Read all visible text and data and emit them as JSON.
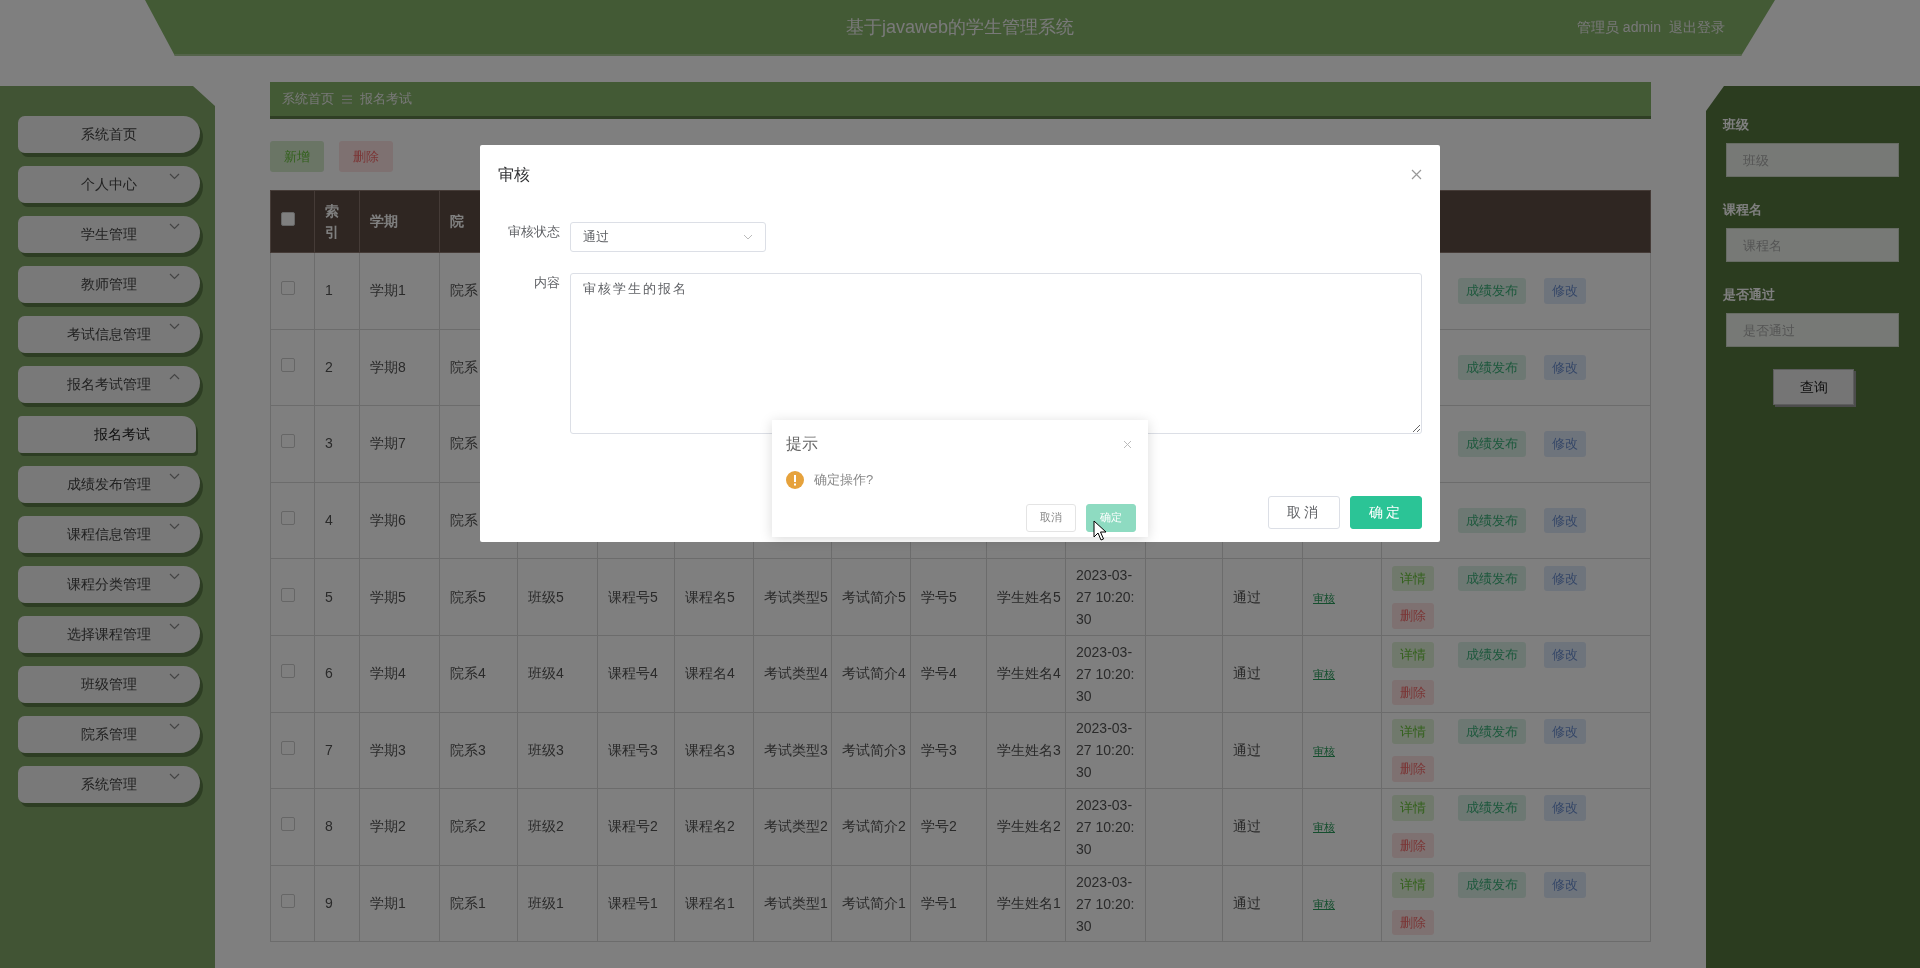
{
  "header": {
    "title": "基于javaweb的学生管理系统",
    "user": "管理员 admin",
    "logout": "退出登录"
  },
  "sidebar": {
    "items": [
      {
        "label": "系统首页",
        "kind": "link"
      },
      {
        "label": "个人中心",
        "kind": "menu",
        "expanded": false
      },
      {
        "label": "学生管理",
        "kind": "menu",
        "expanded": false
      },
      {
        "label": "教师管理",
        "kind": "menu",
        "expanded": false
      },
      {
        "label": "考试信息管理",
        "kind": "menu",
        "expanded": false
      },
      {
        "label": "报名考试管理",
        "kind": "menu",
        "expanded": true,
        "children": [
          {
            "label": "报名考试"
          }
        ]
      },
      {
        "label": "成绩发布管理",
        "kind": "menu",
        "expanded": false
      },
      {
        "label": "课程信息管理",
        "kind": "menu",
        "expanded": false
      },
      {
        "label": "课程分类管理",
        "kind": "menu",
        "expanded": false
      },
      {
        "label": "选择课程管理",
        "kind": "menu",
        "expanded": false
      },
      {
        "label": "班级管理",
        "kind": "menu",
        "expanded": false
      },
      {
        "label": "院系管理",
        "kind": "menu",
        "expanded": false
      },
      {
        "label": "系统管理",
        "kind": "menu",
        "expanded": false
      }
    ]
  },
  "breadcrumb": [
    "系统首页",
    "报名考试"
  ],
  "toolbar": [
    {
      "label": "新增",
      "kind": "add"
    },
    {
      "label": "删除",
      "kind": "delete"
    }
  ],
  "table": {
    "select_all": {
      "checked": false
    },
    "columns": [
      "索引",
      "学期",
      "院"
    ],
    "rows": [
      {
        "checked": false,
        "cells": [
          "1",
          "学期1",
          "院系"
        ],
        "actions": [
          {
            "label": "成绩发布",
            "kind": "publish"
          },
          {
            "label": "修改",
            "kind": "edit"
          }
        ]
      },
      {
        "checked": false,
        "cells": [
          "2",
          "学期8",
          "院系"
        ],
        "actions": [
          {
            "label": "成绩发布",
            "kind": "publish"
          },
          {
            "label": "修改",
            "kind": "edit"
          }
        ]
      },
      {
        "checked": false,
        "cells": [
          "3",
          "学期7",
          "院系"
        ],
        "actions": [
          {
            "label": "成绩发布",
            "kind": "publish"
          },
          {
            "label": "修改",
            "kind": "edit"
          }
        ]
      },
      {
        "checked": false,
        "cells": [
          "4",
          "学期6",
          "院系"
        ],
        "actions": [
          {
            "label": "成绩发布",
            "kind": "publish"
          },
          {
            "label": "修改",
            "kind": "edit"
          }
        ]
      },
      {
        "checked": false,
        "cells": [
          "5",
          "学期5",
          "院系5",
          "班级5",
          "课程号5",
          "课程名5",
          "考试类型5",
          "考试简介5",
          "学号5",
          "学生姓名5",
          "2023-03-27 10:20:30"
        ],
        "passed": "通过",
        "review": "审核",
        "actions": [
          {
            "label": "详情",
            "kind": "detail"
          },
          {
            "label": "成绩发布",
            "kind": "publish"
          },
          {
            "label": "修改",
            "kind": "edit"
          },
          {
            "label": "删除",
            "kind": "delete"
          }
        ]
      },
      {
        "checked": false,
        "cells": [
          "6",
          "学期4",
          "院系4",
          "班级4",
          "课程号4",
          "课程名4",
          "考试类型4",
          "考试简介4",
          "学号4",
          "学生姓名4",
          "2023-03-27 10:20:30"
        ],
        "passed": "通过",
        "review": "审核",
        "actions": [
          {
            "label": "详情",
            "kind": "detail"
          },
          {
            "label": "成绩发布",
            "kind": "publish"
          },
          {
            "label": "修改",
            "kind": "edit"
          },
          {
            "label": "删除",
            "kind": "delete"
          }
        ]
      },
      {
        "checked": false,
        "cells": [
          "7",
          "学期3",
          "院系3",
          "班级3",
          "课程号3",
          "课程名3",
          "考试类型3",
          "考试简介3",
          "学号3",
          "学生姓名3",
          "2023-03-27 10:20:30"
        ],
        "passed": "通过",
        "review": "审核",
        "actions": [
          {
            "label": "详情",
            "kind": "detail"
          },
          {
            "label": "成绩发布",
            "kind": "publish"
          },
          {
            "label": "修改",
            "kind": "edit"
          },
          {
            "label": "删除",
            "kind": "delete"
          }
        ]
      },
      {
        "checked": false,
        "cells": [
          "8",
          "学期2",
          "院系2",
          "班级2",
          "课程号2",
          "课程名2",
          "考试类型2",
          "考试简介2",
          "学号2",
          "学生姓名2",
          "2023-03-27 10:20:30"
        ],
        "passed": "通过",
        "review": "审核",
        "actions": [
          {
            "label": "详情",
            "kind": "detail"
          },
          {
            "label": "成绩发布",
            "kind": "publish"
          },
          {
            "label": "修改",
            "kind": "edit"
          },
          {
            "label": "删除",
            "kind": "delete"
          }
        ]
      },
      {
        "checked": false,
        "cells": [
          "9",
          "学期1",
          "院系1",
          "班级1",
          "课程号1",
          "课程名1",
          "考试类型1",
          "考试简介1",
          "学号1",
          "学生姓名1",
          "2023-03-27 10:20:30"
        ],
        "passed": "通过",
        "review": "审核",
        "actions": [
          {
            "label": "详情",
            "kind": "detail"
          },
          {
            "label": "成绩发布",
            "kind": "publish"
          },
          {
            "label": "修改",
            "kind": "edit"
          },
          {
            "label": "删除",
            "kind": "delete"
          }
        ]
      }
    ]
  },
  "search": {
    "fields": [
      {
        "label": "班级",
        "placeholder": "班级"
      },
      {
        "label": "课程名",
        "placeholder": "课程名"
      },
      {
        "label": "是否通过",
        "placeholder": "是否通过"
      }
    ],
    "button": "查询"
  },
  "dialog": {
    "title": "审核",
    "fields": [
      {
        "label": "审核状态",
        "kind": "select",
        "value": "通过"
      },
      {
        "label": "内容",
        "kind": "textarea",
        "value": "审核学生的报名"
      }
    ],
    "buttons": [
      {
        "label": "取消",
        "kind": "cancel"
      },
      {
        "label": "确定",
        "kind": "primary"
      }
    ]
  },
  "confirm": {
    "title": "提示",
    "message": "确定操作?",
    "buttons": [
      {
        "label": "取消",
        "kind": "cancel"
      },
      {
        "label": "确定",
        "kind": "primary"
      }
    ]
  }
}
